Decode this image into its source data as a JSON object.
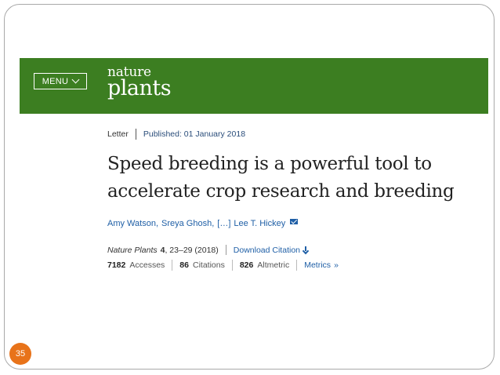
{
  "header": {
    "menu_label": "MENU",
    "logo_line1": "nature",
    "logo_line2": "plants",
    "brand_color": "#3c7e21"
  },
  "article": {
    "type": "Letter",
    "published": "Published: 01 January 2018",
    "title": "Speed breeding is a powerful tool to accelerate crop research and breeding",
    "authors": {
      "author1": "Amy Watson,",
      "author2": "Sreya Ghosh,",
      "ellipsis": "[…]",
      "author3": "Lee T. Hickey"
    },
    "citation": {
      "journal": "Nature Plants",
      "volume": "4",
      "pages": ", 23–29 (2018)",
      "download_label": "Download Citation"
    },
    "metrics": {
      "accesses_value": "7182",
      "accesses_label": "Accesses",
      "citations_value": "86",
      "citations_label": "Citations",
      "altmetric_value": "826",
      "altmetric_label": "Altmetric",
      "metrics_link": "Metrics",
      "metrics_arrow": "»"
    }
  },
  "slide": {
    "page_number": "35",
    "accent_color": "#e8731a"
  }
}
